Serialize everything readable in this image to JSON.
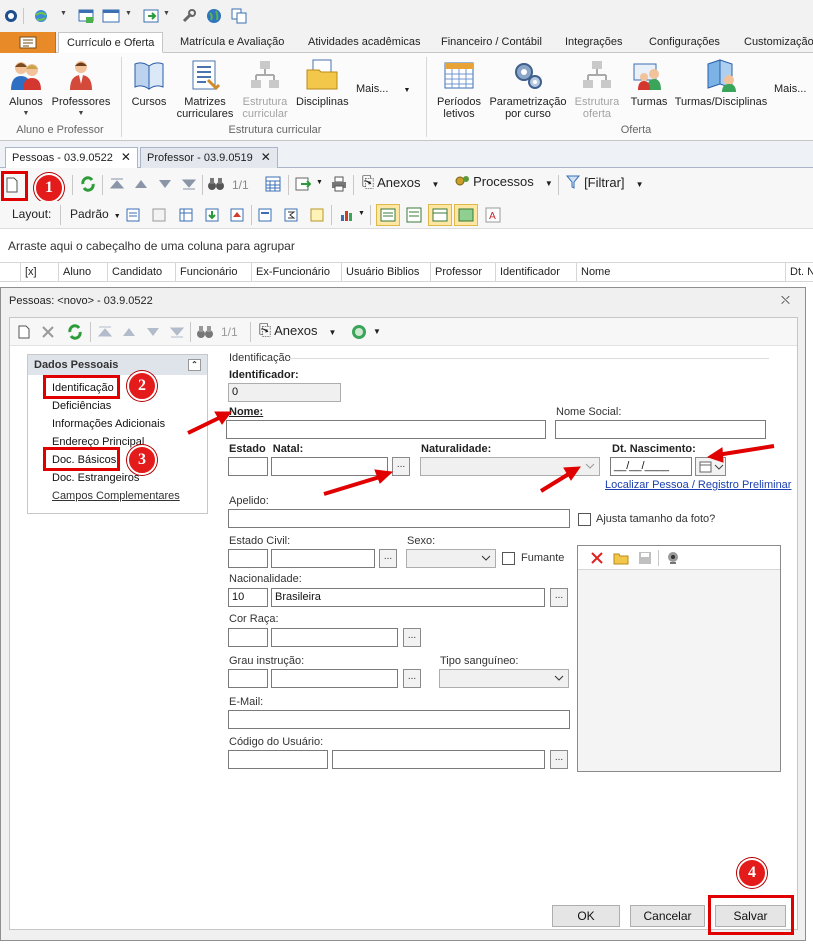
{
  "ribbon": {
    "tabs": [
      "Currículo e Oferta",
      "Matrícula e Avaliação",
      "Atividades acadêmicas",
      "Financeiro / Contábil",
      "Integrações",
      "Configurações",
      "Customização"
    ],
    "buttons": {
      "alunos": "Alunos",
      "professores": "Professores",
      "cursos": "Cursos",
      "matrizes": "Matrizes curriculares",
      "estrutura": "Estrutura curricular",
      "disciplinas": "Disciplinas",
      "mais1": "Mais...",
      "periodos": "Períodos letivos",
      "parametrizacao": "Parametrização por curso",
      "estrutura_oferta": "Estrutura oferta",
      "turmas": "Turmas",
      "turmas_disciplinas": "Turmas/Disciplinas",
      "mais2": "Mais..."
    },
    "groups": {
      "aluno_professor": "Aluno e Professor",
      "estrutura_curricular": "Estrutura curricular",
      "oferta": "Oferta"
    }
  },
  "doc_tabs": [
    "Pessoas - 03.9.0522",
    "Professor - 03.9.0519"
  ],
  "toolbar": {
    "page_counter": "1/1",
    "anexos": "Anexos",
    "processos": "Processos",
    "filtrar": "[Filtrar]",
    "layout_label": "Layout:",
    "layout_value": "Padrão"
  },
  "grid": {
    "group_hint": "Arraste aqui o cabeçalho de uma coluna para agrupar",
    "columns": [
      "[x]",
      "Aluno",
      "Candidato",
      "Funcionário",
      "Ex-Funcionário",
      "Usuário Biblios",
      "Professor",
      "Identificador",
      "Nome",
      "Dt. N"
    ]
  },
  "modal": {
    "title": "Pessoas: <novo> - 03.9.0522",
    "toolbar": {
      "page_counter": "1/1",
      "anexos": "Anexos"
    },
    "nav": {
      "header": "Dados Pessoais",
      "items": [
        "Identificação",
        "Deficiências",
        "Informações Adicionais",
        "Endereço Principal",
        "Doc. Básicos",
        "Doc. Estrangeiros",
        "Campos Complementares"
      ]
    },
    "form": {
      "section": "Identificação",
      "identificador_label": "Identificador:",
      "identificador_value": "0",
      "nome_label": "Nome:",
      "nome_social_label": "Nome Social:",
      "estado_label": "Estado",
      "natal_label": "Natal:",
      "naturalidade_label": "Naturalidade:",
      "dt_nascimento_label": "Dt. Nascimento:",
      "dt_nascimento_value": "__/__/____",
      "localizar_link": "Localizar Pessoa / Registro Preliminar",
      "apelido_label": "Apelido:",
      "ajusta_foto_label": "Ajusta tamanho da foto?",
      "estado_civil_label": "Estado Civil:",
      "sexo_label": "Sexo:",
      "fumante_label": "Fumante",
      "nacionalidade_label": "Nacionalidade:",
      "nacionalidade_code": "10",
      "nacionalidade_value": "Brasileira",
      "cor_raca_label": "Cor Raça:",
      "grau_instrucao_label": "Grau instrução:",
      "tipo_sanguineo_label": "Tipo sanguíneo:",
      "email_label": "E-Mail:",
      "codigo_usuario_label": "Código do Usuário:"
    },
    "buttons": {
      "ok": "OK",
      "cancelar": "Cancelar",
      "salvar": "Salvar"
    }
  },
  "annotations": {
    "step1": "1",
    "step2": "2",
    "step3": "3",
    "step4": "4"
  },
  "colors": {
    "accent_orange": "#e88a28",
    "annotation_red": "#e31b1b",
    "link_blue": "#1c3fb0"
  }
}
